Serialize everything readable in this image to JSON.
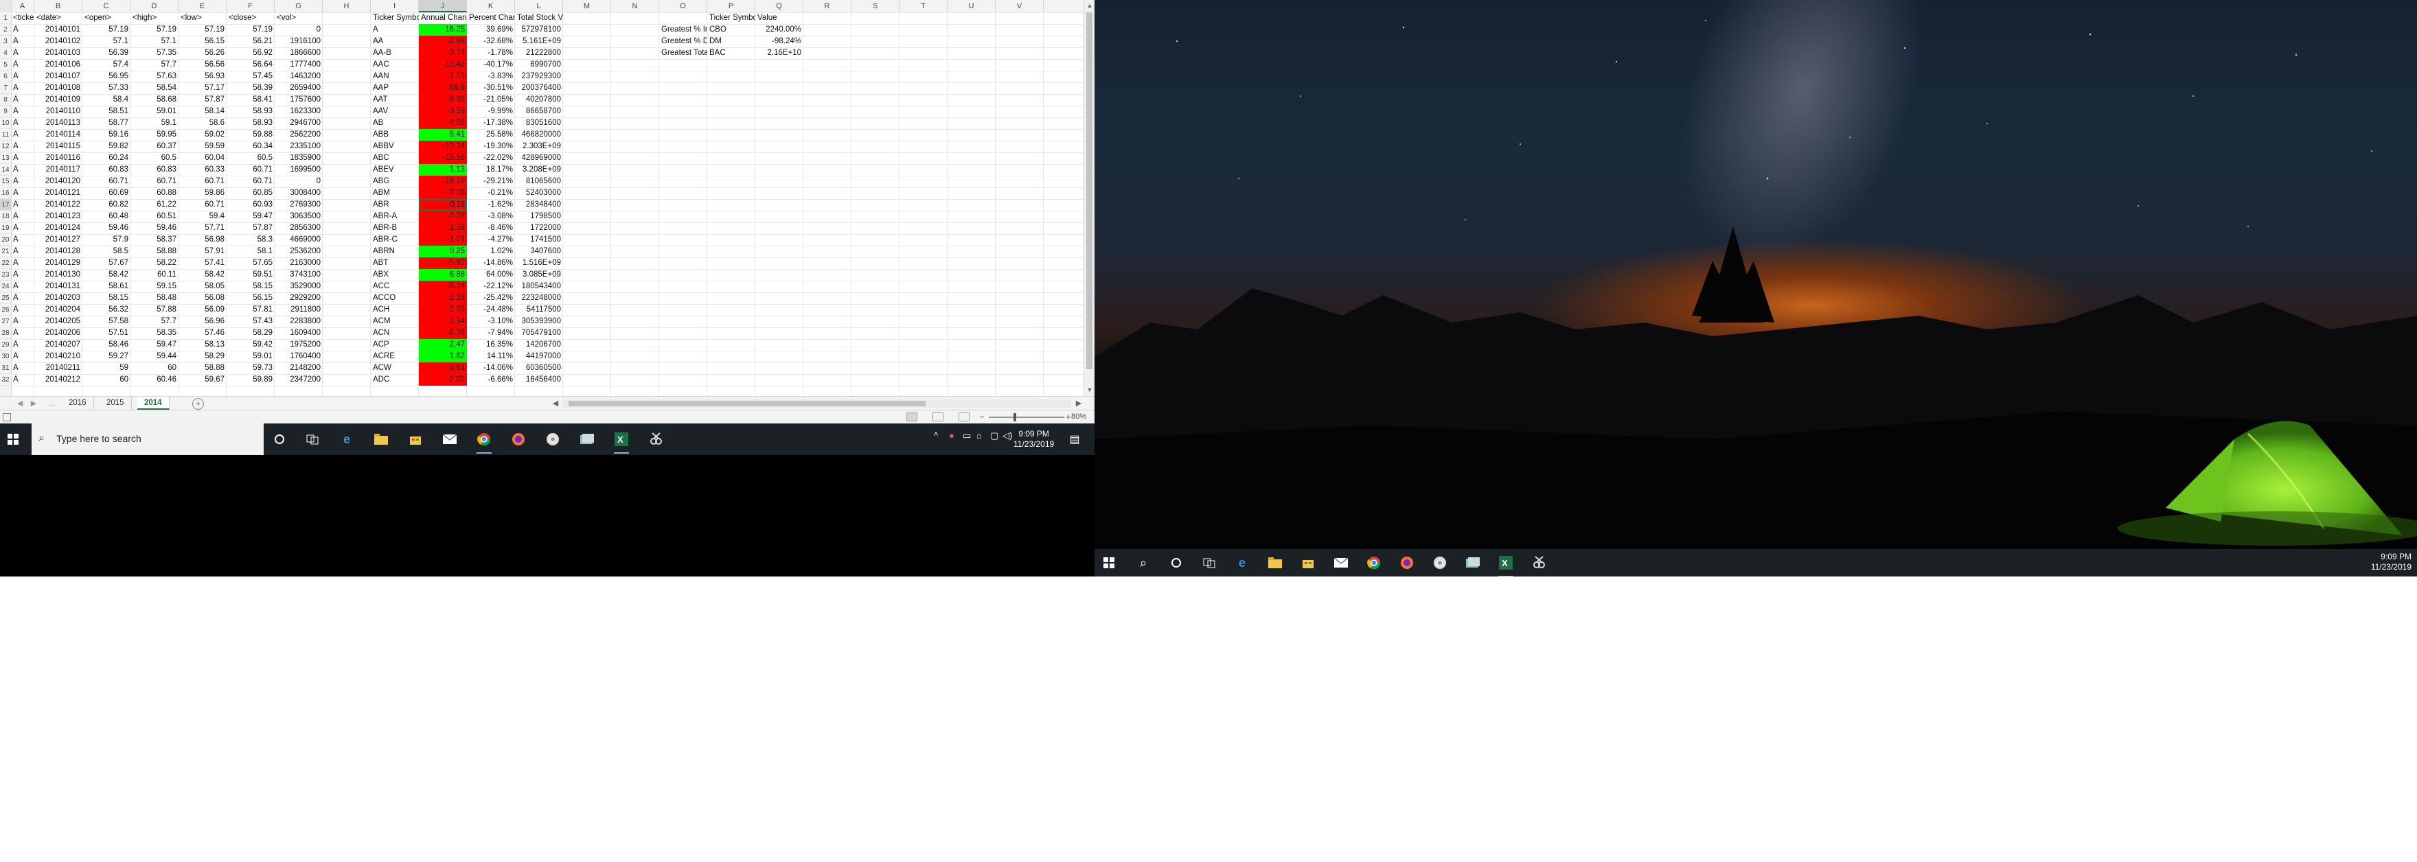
{
  "excel": {
    "columns": [
      "A",
      "B",
      "C",
      "D",
      "E",
      "F",
      "G",
      "H",
      "I",
      "J",
      "K",
      "L",
      "M",
      "N",
      "O",
      "P",
      "Q",
      "R",
      "S",
      "T",
      "U",
      "V"
    ],
    "selected_column": "J",
    "selected_row": 17,
    "rows_visible": 32,
    "header_row": {
      "A": "<ticker>",
      "B": "<date>",
      "C": "<open>",
      "D": "<high>",
      "E": "<low>",
      "F": "<close>",
      "G": "<vol>",
      "I": "Ticker Symbol",
      "J": "Annual Change",
      "K": "Percent Change",
      "L": "Total Stock Volume",
      "O": "",
      "P": "Ticker Symbol",
      "Q": "Value"
    },
    "raw_rows": [
      [
        "A",
        "20140101",
        "57.19",
        "57.19",
        "57.19",
        "57.19",
        "0"
      ],
      [
        "A",
        "20140102",
        "57.1",
        "57.1",
        "56.15",
        "56.21",
        "1916100"
      ],
      [
        "A",
        "20140103",
        "56.39",
        "57.35",
        "56.26",
        "56.92",
        "1866600"
      ],
      [
        "A",
        "20140106",
        "57.4",
        "57.7",
        "56.56",
        "56.64",
        "1777400"
      ],
      [
        "A",
        "20140107",
        "56.95",
        "57.63",
        "56.93",
        "57.45",
        "1463200"
      ],
      [
        "A",
        "20140108",
        "57.33",
        "58.54",
        "57.17",
        "58.39",
        "2659400"
      ],
      [
        "A",
        "20140109",
        "58.4",
        "58.68",
        "57.87",
        "58.41",
        "1757600"
      ],
      [
        "A",
        "20140110",
        "58.51",
        "59.01",
        "58.14",
        "58.93",
        "1623300"
      ],
      [
        "A",
        "20140113",
        "58.77",
        "59.1",
        "58.6",
        "58.93",
        "2946700"
      ],
      [
        "A",
        "20140114",
        "59.16",
        "59.95",
        "59.02",
        "59.88",
        "2562200"
      ],
      [
        "A",
        "20140115",
        "59.82",
        "60.37",
        "59.59",
        "60.34",
        "2335100"
      ],
      [
        "A",
        "20140116",
        "60.24",
        "60.5",
        "60.04",
        "60.5",
        "1835900"
      ],
      [
        "A",
        "20140117",
        "60.83",
        "60.83",
        "60.33",
        "60.71",
        "1699500"
      ],
      [
        "A",
        "20140120",
        "60.71",
        "60.71",
        "60.71",
        "60.71",
        "0"
      ],
      [
        "A",
        "20140121",
        "60.69",
        "60.88",
        "59.86",
        "60.85",
        "3008400"
      ],
      [
        "A",
        "20140122",
        "60.82",
        "61.22",
        "60.71",
        "60.93",
        "2769300"
      ],
      [
        "A",
        "20140123",
        "60.48",
        "60.51",
        "59.4",
        "59.47",
        "3063500"
      ],
      [
        "A",
        "20140124",
        "59.46",
        "59.46",
        "57.71",
        "57.87",
        "2856300"
      ],
      [
        "A",
        "20140127",
        "57.9",
        "58.37",
        "56.98",
        "58.3",
        "4669000"
      ],
      [
        "A",
        "20140128",
        "58.5",
        "58.88",
        "57.91",
        "58.1",
        "2536200"
      ],
      [
        "A",
        "20140129",
        "57.67",
        "58.22",
        "57.41",
        "57.65",
        "2163000"
      ],
      [
        "A",
        "20140130",
        "58.42",
        "60.11",
        "58.42",
        "59.51",
        "3743100"
      ],
      [
        "A",
        "20140131",
        "58.61",
        "59.15",
        "58.05",
        "58.15",
        "3529000"
      ],
      [
        "A",
        "20140203",
        "58.15",
        "58.48",
        "56.08",
        "56.15",
        "2929200"
      ],
      [
        "A",
        "20140204",
        "56.32",
        "57.88",
        "56.09",
        "57.81",
        "2911800"
      ],
      [
        "A",
        "20140205",
        "57.58",
        "57.7",
        "56.96",
        "57.43",
        "2283800"
      ],
      [
        "A",
        "20140206",
        "57.51",
        "58.35",
        "57.46",
        "58.29",
        "1609400"
      ],
      [
        "A",
        "20140207",
        "58.46",
        "59.47",
        "58.13",
        "59.42",
        "1975200"
      ],
      [
        "A",
        "20140210",
        "59.27",
        "59.44",
        "58.29",
        "59.01",
        "1760400"
      ],
      [
        "A",
        "20140211",
        "59",
        "60",
        "58.88",
        "59.73",
        "2148200"
      ],
      [
        "A",
        "20140212",
        "60",
        "60.46",
        "59.67",
        "59.89",
        "2347200"
      ]
    ],
    "summary_rows": [
      {
        "ticker": "A",
        "change": "16.25",
        "change_color": "green",
        "pct": "39.69%",
        "vol": "572978100"
      },
      {
        "ticker": "AA",
        "change": "-2.88",
        "change_color": "red",
        "pct": "-32.68%",
        "vol": "5.161E+09"
      },
      {
        "ticker": "AA-B",
        "change": "-0.74",
        "change_color": "red",
        "pct": "-1.78%",
        "vol": "21222800"
      },
      {
        "ticker": "AAC",
        "change": "-10.42",
        "change_color": "red",
        "pct": "-40.17%",
        "vol": "6990700"
      },
      {
        "ticker": "AAN",
        "change": "-1.13",
        "change_color": "red",
        "pct": "-3.83%",
        "vol": "237929300"
      },
      {
        "ticker": "AAP",
        "change": "-68.8",
        "change_color": "red",
        "pct": "-30.51%",
        "vol": "200376400"
      },
      {
        "ticker": "AAT",
        "change": "-6.98",
        "change_color": "red",
        "pct": "-21.05%",
        "vol": "40207800"
      },
      {
        "ticker": "AAV",
        "change": "-0.58",
        "change_color": "red",
        "pct": "-9.99%",
        "vol": "86658700"
      },
      {
        "ticker": "AB",
        "change": "-4.66",
        "change_color": "red",
        "pct": "-17.38%",
        "vol": "83051600"
      },
      {
        "ticker": "ABB",
        "change": "5.41",
        "change_color": "green",
        "pct": "25.58%",
        "vol": "466820000"
      },
      {
        "ticker": "ABBV",
        "change": "-10.34",
        "change_color": "red",
        "pct": "-19.30%",
        "vol": "2.303E+09"
      },
      {
        "ticker": "ABC",
        "change": "-15.56",
        "change_color": "red",
        "pct": "-22.02%",
        "vol": "428969000"
      },
      {
        "ticker": "ABEV",
        "change": "1.13",
        "change_color": "green",
        "pct": "18.17%",
        "vol": "3.208E+09"
      },
      {
        "ticker": "ABG",
        "change": "-18.19",
        "change_color": "red",
        "pct": "-29.21%",
        "vol": "81065600"
      },
      {
        "ticker": "ABM",
        "change": "-0.06",
        "change_color": "red",
        "pct": "-0.21%",
        "vol": "52403000"
      },
      {
        "ticker": "ABR",
        "change": "-0.11",
        "change_color": "red",
        "pct": "-1.62%",
        "vol": "28348400"
      },
      {
        "ticker": "ABR-A",
        "change": "-0.78",
        "change_color": "red",
        "pct": "-3.08%",
        "vol": "1798500"
      },
      {
        "ticker": "ABR-B",
        "change": "-1.98",
        "change_color": "red",
        "pct": "-8.46%",
        "vol": "1722000"
      },
      {
        "ticker": "ABR-C",
        "change": "-1.01",
        "change_color": "red",
        "pct": "-4.27%",
        "vol": "1741500"
      },
      {
        "ticker": "ABRN",
        "change": "0.25",
        "change_color": "green",
        "pct": "1.02%",
        "vol": "3407600"
      },
      {
        "ticker": "ABT",
        "change": "-5.92",
        "change_color": "red",
        "pct": "-14.86%",
        "vol": "1.516E+09"
      },
      {
        "ticker": "ABX",
        "change": "6.88",
        "change_color": "green",
        "pct": "64.00%",
        "vol": "3.085E+09"
      },
      {
        "ticker": "ACC",
        "change": "-8.14",
        "change_color": "red",
        "pct": "-22.12%",
        "vol": "180543400"
      },
      {
        "ticker": "ACCO",
        "change": "-2.28",
        "change_color": "red",
        "pct": "-25.42%",
        "vol": "223248000"
      },
      {
        "ticker": "ACH",
        "change": "-2.92",
        "change_color": "red",
        "pct": "-24.48%",
        "vol": "54117500"
      },
      {
        "ticker": "ACM",
        "change": "-0.94",
        "change_color": "red",
        "pct": "-3.10%",
        "vol": "305393900"
      },
      {
        "ticker": "ACN",
        "change": "-6.36",
        "change_color": "red",
        "pct": "-7.94%",
        "vol": "705479100"
      },
      {
        "ticker": "ACP",
        "change": "2.47",
        "change_color": "green",
        "pct": "16.35%",
        "vol": "14206700"
      },
      {
        "ticker": "ACRE",
        "change": "1.62",
        "change_color": "green",
        "pct": "14.11%",
        "vol": "44197000"
      },
      {
        "ticker": "ACW",
        "change": "-0.61",
        "change_color": "red",
        "pct": "-14.06%",
        "vol": "60360500"
      },
      {
        "ticker": "ADC",
        "change": "-2.03",
        "change_color": "red",
        "pct": "-6.66%",
        "vol": "16456400"
      }
    ],
    "greatest": [
      {
        "label": "Greatest % Increase",
        "ticker": "CBO",
        "value": "2240.00%"
      },
      {
        "label": "Greatest % Decrease",
        "ticker": "DM",
        "value": "-98.24%"
      },
      {
        "label": "Greatest Total Volume",
        "ticker": "BAC",
        "value": "2.16E+10"
      }
    ],
    "sheet_tabs": [
      "2016",
      "2015",
      "2014"
    ],
    "active_sheet": "2014",
    "zoom": "80%"
  },
  "taskbar1": {
    "search_placeholder": "Type here to search",
    "time": "9:09 PM",
    "date": "11/23/2019"
  },
  "taskbar2": {
    "time": "9:09 PM",
    "date": "11/23/2019"
  },
  "colors": {
    "excel_green": "#217346",
    "positive_fill": "#00ff00",
    "negative_fill": "#ff0000",
    "taskbar": "#1c2126",
    "tent": "#7cd11f"
  }
}
